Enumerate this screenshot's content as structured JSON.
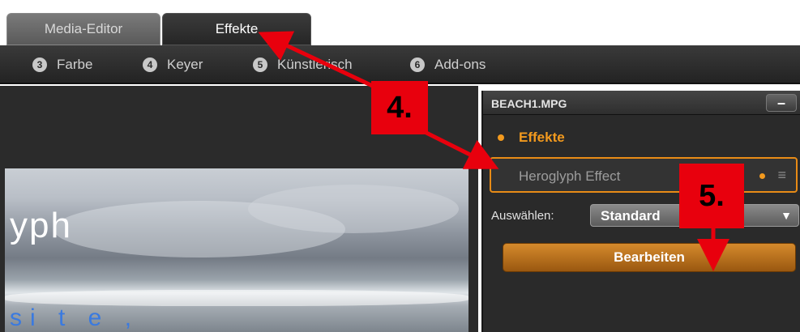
{
  "tabs": [
    {
      "label": "Media-Editor",
      "active": false
    },
    {
      "label": "Effekte",
      "active": true
    }
  ],
  "subnav": [
    {
      "number": "3",
      "label": "Farbe"
    },
    {
      "number": "4",
      "label": "Keyer"
    },
    {
      "number": "5",
      "label": "Künstlerisch"
    },
    {
      "number": "6",
      "label": "Add-ons"
    }
  ],
  "preview": {
    "overlay_text": "yph",
    "bottom_text": "si t e ,"
  },
  "panel": {
    "title": "BEACH1.MPG",
    "minimize_label": "–",
    "section_label": "Effekte",
    "effect_name": "Heroglyph Effect",
    "menu_icon": "≡",
    "select_label": "Auswählen:",
    "select_value": "Standard",
    "select_arrow": "▼",
    "edit_button": "Bearbeiten"
  },
  "callouts": {
    "step4": "4.",
    "step5": "5."
  },
  "colors": {
    "accent_orange": "#f39a1e",
    "callout_red": "#e8000d"
  }
}
